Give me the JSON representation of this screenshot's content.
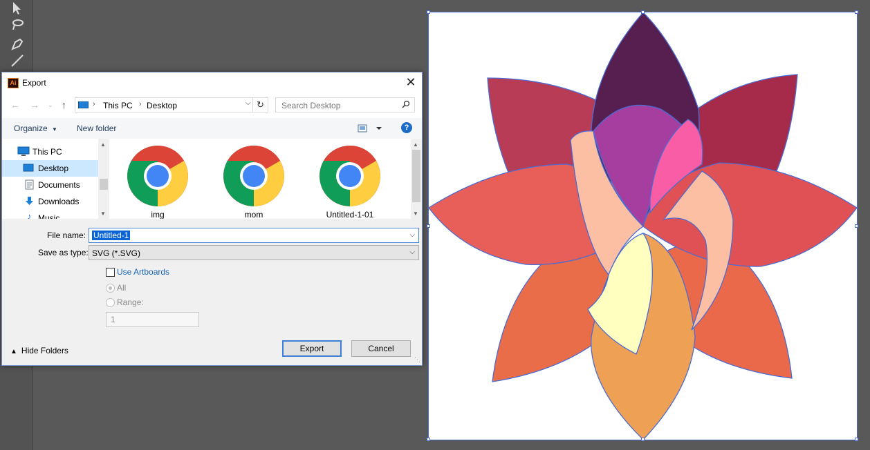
{
  "dialog": {
    "title": "Export",
    "app_icon_text": "Ai",
    "close_glyph": "✕",
    "breadcrumb": [
      "This PC",
      "Desktop"
    ],
    "search_placeholder": "Search Desktop",
    "organize_label": "Organize",
    "new_folder_label": "New folder",
    "help_glyph": "?",
    "nav_items": [
      {
        "label": "This PC",
        "icon": "pc-icon"
      },
      {
        "label": "Desktop",
        "icon": "desktop-icon",
        "selected": true
      },
      {
        "label": "Documents",
        "icon": "documents-icon"
      },
      {
        "label": "Downloads",
        "icon": "downloads-icon"
      },
      {
        "label": "Music",
        "icon": "music-icon"
      }
    ],
    "files": [
      {
        "name": "img",
        "icon": "chrome-icon"
      },
      {
        "name": "mom",
        "icon": "chrome-icon"
      },
      {
        "name": "Untitled-1-01",
        "icon": "chrome-icon"
      }
    ],
    "file_name_label": "File name:",
    "file_name_value": "Untitled-1",
    "save_as_type_label": "Save as type:",
    "save_as_type_value": "SVG (*.SVG)",
    "use_artboards_label": "Use Artboards",
    "use_artboards_checked": false,
    "radio_all_label": "All",
    "radio_range_label": "Range:",
    "range_value": "1",
    "hide_folders_label": "Hide Folders",
    "export_label": "Export",
    "cancel_label": "Cancel"
  },
  "artwork": {
    "description_icon": "lotus-flower-artwork",
    "petal_colors": [
      "#561f4f",
      "#b83c56",
      "#a62b4b",
      "#e05155",
      "#e85f5a",
      "#ea6d4a",
      "#e9694a",
      "#eea055",
      "#a63ea0",
      "#f85da5",
      "#fdbfa3",
      "#ffffc0"
    ],
    "selection_color": "#4a6cd4"
  },
  "toolbar": {
    "tools": [
      "selection-tool-icon",
      "lasso-tool-icon",
      "pen-tool-icon",
      "line-tool-icon"
    ]
  }
}
